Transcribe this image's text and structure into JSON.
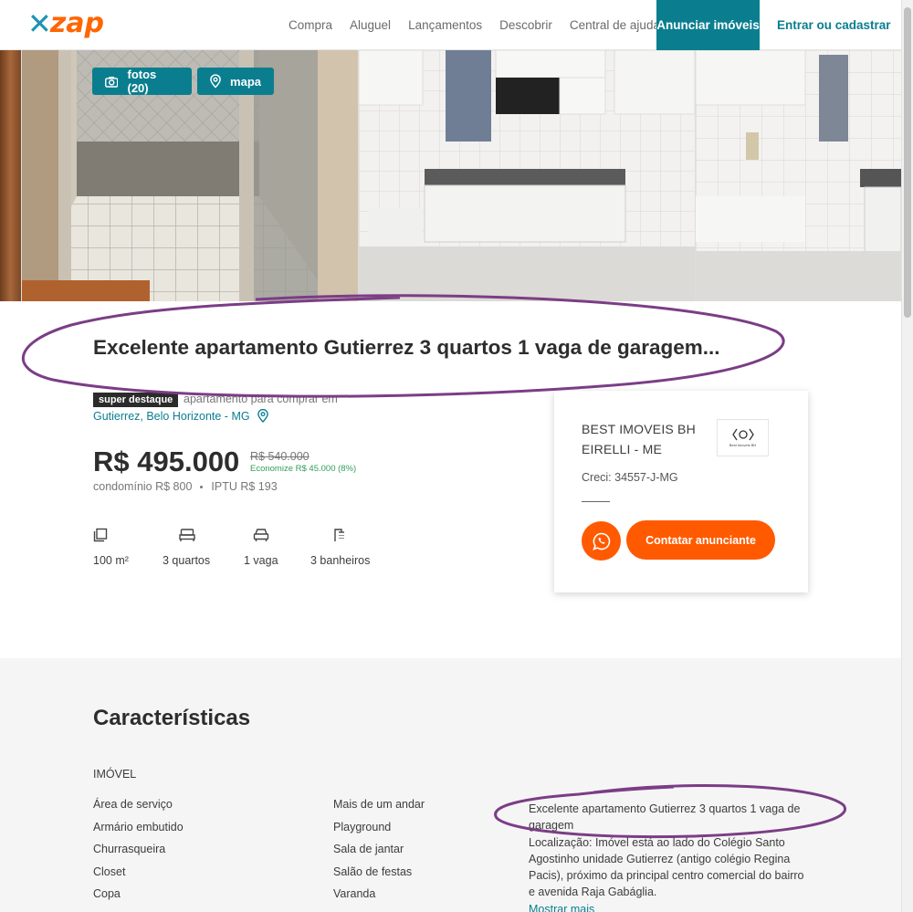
{
  "header": {
    "logo_text": "zap",
    "nav": [
      "Compra",
      "Aluguel",
      "Lançamentos",
      "Descobrir",
      "Central de ajuda"
    ],
    "cta": "Anunciar imóveis",
    "login": "Entrar ou cadastrar"
  },
  "gallery": {
    "photos_button": "fotos (20)",
    "map_button": "mapa"
  },
  "listing": {
    "title": "Excelente apartamento Gutierrez 3 quartos 1 vaga de garagem...",
    "badge": "super destaque",
    "type": "apartamento para comprar em",
    "location": "Gutierrez, Belo Horizonte - MG",
    "price": "R$ 495.000",
    "old_price": "R$ 540.000",
    "saving": "Economize R$ 45.000 (8%)",
    "condo": "condomínio R$ 800",
    "iptu": "IPTU R$ 193",
    "amenities": [
      {
        "icon": "area-icon",
        "label": "100 m²"
      },
      {
        "icon": "bed-icon",
        "label": "3 quartos"
      },
      {
        "icon": "car-icon",
        "label": "1 vaga"
      },
      {
        "icon": "shower-icon",
        "label": "3 banheiros"
      }
    ]
  },
  "contact": {
    "agency": "BEST IMOVEIS BH EIRELLI - ME",
    "logo_caption": "Best Imoveis BH",
    "creci": "Creci: 34557-J-MG",
    "contact_button": "Contatar anunciante"
  },
  "characteristics": {
    "title": "Características",
    "subtitle": "IMÓVEL",
    "col1": [
      "Área de serviço",
      "Armário embutido",
      "Churrasqueira",
      "Closet",
      "Copa"
    ],
    "col2": [
      "Mais de um andar",
      "Playground",
      "Sala de jantar",
      "Salão de festas",
      "Varanda"
    ],
    "description_1": "Excelente apartamento Gutierrez 3 quartos 1 vaga de garagem",
    "description_2": "Localização: Imóvel está ao lado do Colégio Santo Agostinho unidade Gutierrez (antigo colégio Regina Pacis), próximo da principal centro comercial do bairro e avenida Raja Gabáglia.",
    "more": "Mostrar mais"
  },
  "colors": {
    "brand_teal": "#0a7e8f",
    "brand_orange": "#ff5a00",
    "annotation_purple": "#7b3d86"
  }
}
